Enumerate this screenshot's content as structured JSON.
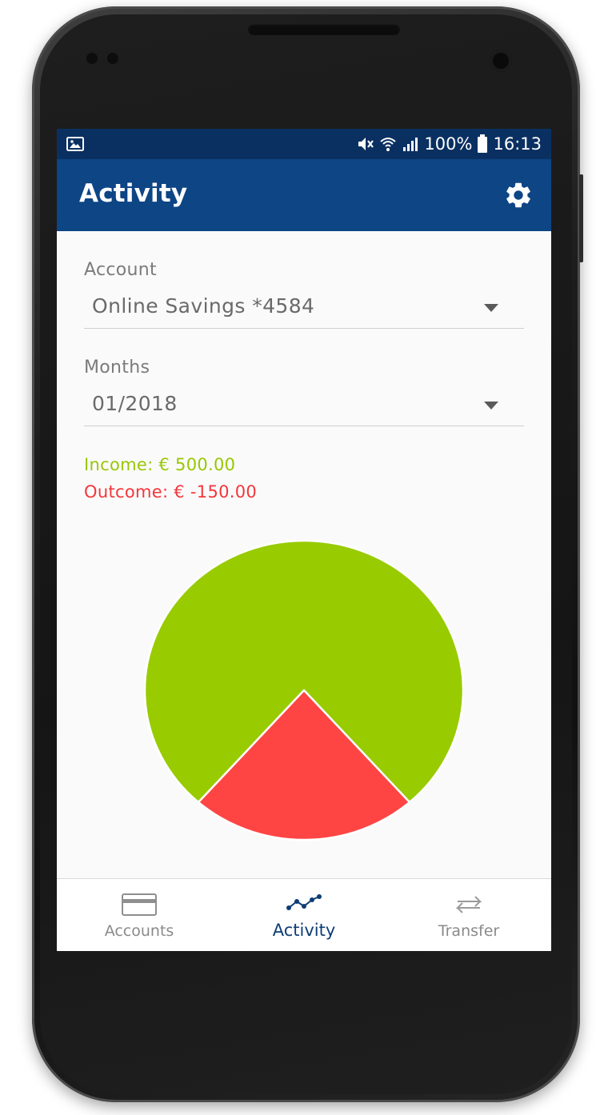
{
  "status_bar": {
    "battery": "100%",
    "time": "16:13",
    "icons": [
      "image-icon",
      "vibrate-mute-icon",
      "wifi-icon",
      "signal-icon",
      "battery-icon"
    ]
  },
  "app_bar": {
    "title": "Activity",
    "settings_icon": "gear-icon"
  },
  "filters": {
    "account": {
      "label": "Account",
      "value": "Online Savings *4584"
    },
    "months": {
      "label": "Months",
      "value": "01/2018"
    }
  },
  "summary": {
    "income": "Income: € 500.00",
    "outcome": "Outcome: € -150.00"
  },
  "chart_data": {
    "type": "pie",
    "slices": [
      {
        "label": "Income",
        "value": 500,
        "color": "#98cb00"
      },
      {
        "label": "Outcome",
        "value": 150,
        "color": "#ff4444"
      }
    ]
  },
  "bottom_nav": {
    "items": [
      {
        "label": "Accounts",
        "icon": "card-icon",
        "active": false
      },
      {
        "label": "Activity",
        "icon": "activity-chart-icon",
        "active": true
      },
      {
        "label": "Transfer",
        "icon": "transfer-arrows-icon",
        "active": false
      }
    ]
  },
  "colors": {
    "status_bar": "#0a3061",
    "app_bar": "#0d4585",
    "income": "#98c704",
    "outcome": "#f4363b",
    "active_nav": "#0d3d75"
  }
}
